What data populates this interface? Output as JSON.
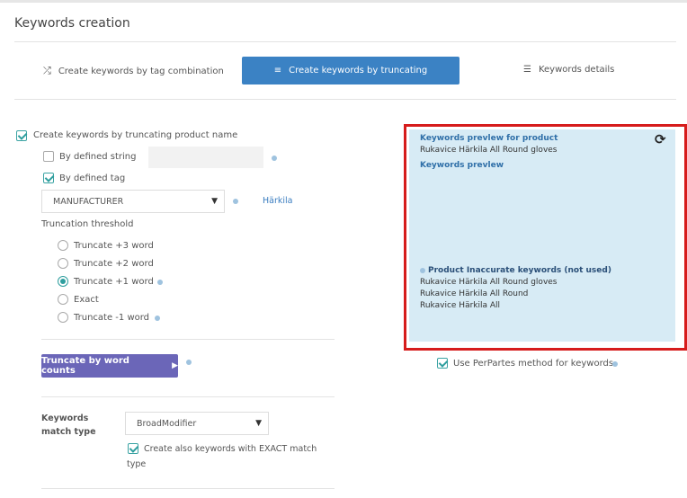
{
  "page": {
    "title": "Keywords creation"
  },
  "tabs": [
    {
      "label": "Create keywords by tag combination",
      "icon": "shuffle-icon",
      "active": false
    },
    {
      "label": "Create keywords by truncating",
      "icon": "sort-icon",
      "active": true
    },
    {
      "label": "Keywords details",
      "icon": "list-icon",
      "active": false
    }
  ],
  "form": {
    "truncate_product_name": {
      "label": "Create keywords by truncating product name",
      "checked": true
    },
    "by_defined_string": {
      "label": "By defined string",
      "checked": false,
      "value": ""
    },
    "by_defined_tag": {
      "label": "By defined tag",
      "checked": true
    },
    "tag_select": {
      "value": "MANUFACTURER",
      "tag_value": "Härkila"
    },
    "threshold": {
      "label": "Truncation threshold",
      "options": [
        "Truncate +3 word",
        "Truncate +2 word",
        "Truncate +1 word",
        "Exact",
        "Truncate -1 word"
      ],
      "selected": "Truncate +1 word"
    },
    "truncate_button": "Truncate by word counts",
    "match_type": {
      "label_line1": "Keywords",
      "label_line2": "match type",
      "value": "BroadModifier"
    },
    "exact_match": {
      "label_line1": "Create also keywords with EXACT match",
      "label_line2": "type",
      "checked": true
    }
  },
  "preview": {
    "product_heading": "Keywords prevlew for product",
    "product_name": "Rukavice Härkila All Round gloves",
    "preview_heading": "Keywords prevlew",
    "inaccurate_heading": "Product Inaccurate keywords (not used)",
    "inaccurate_items": [
      "Rukavice Härkila All Round gloves",
      "Rukavice Härkila All Round",
      "Rukavice Härkila All"
    ],
    "refresh_icon": "refresh-icon"
  },
  "perpartes": {
    "label": "Use PerPartes method for keywords",
    "checked": true
  },
  "colors": {
    "active_tab": "#3b82c4",
    "button": "#6b66b8",
    "panel": "#d7ebf5",
    "frame": "#d61c1c",
    "check": "#2e9e9e"
  }
}
